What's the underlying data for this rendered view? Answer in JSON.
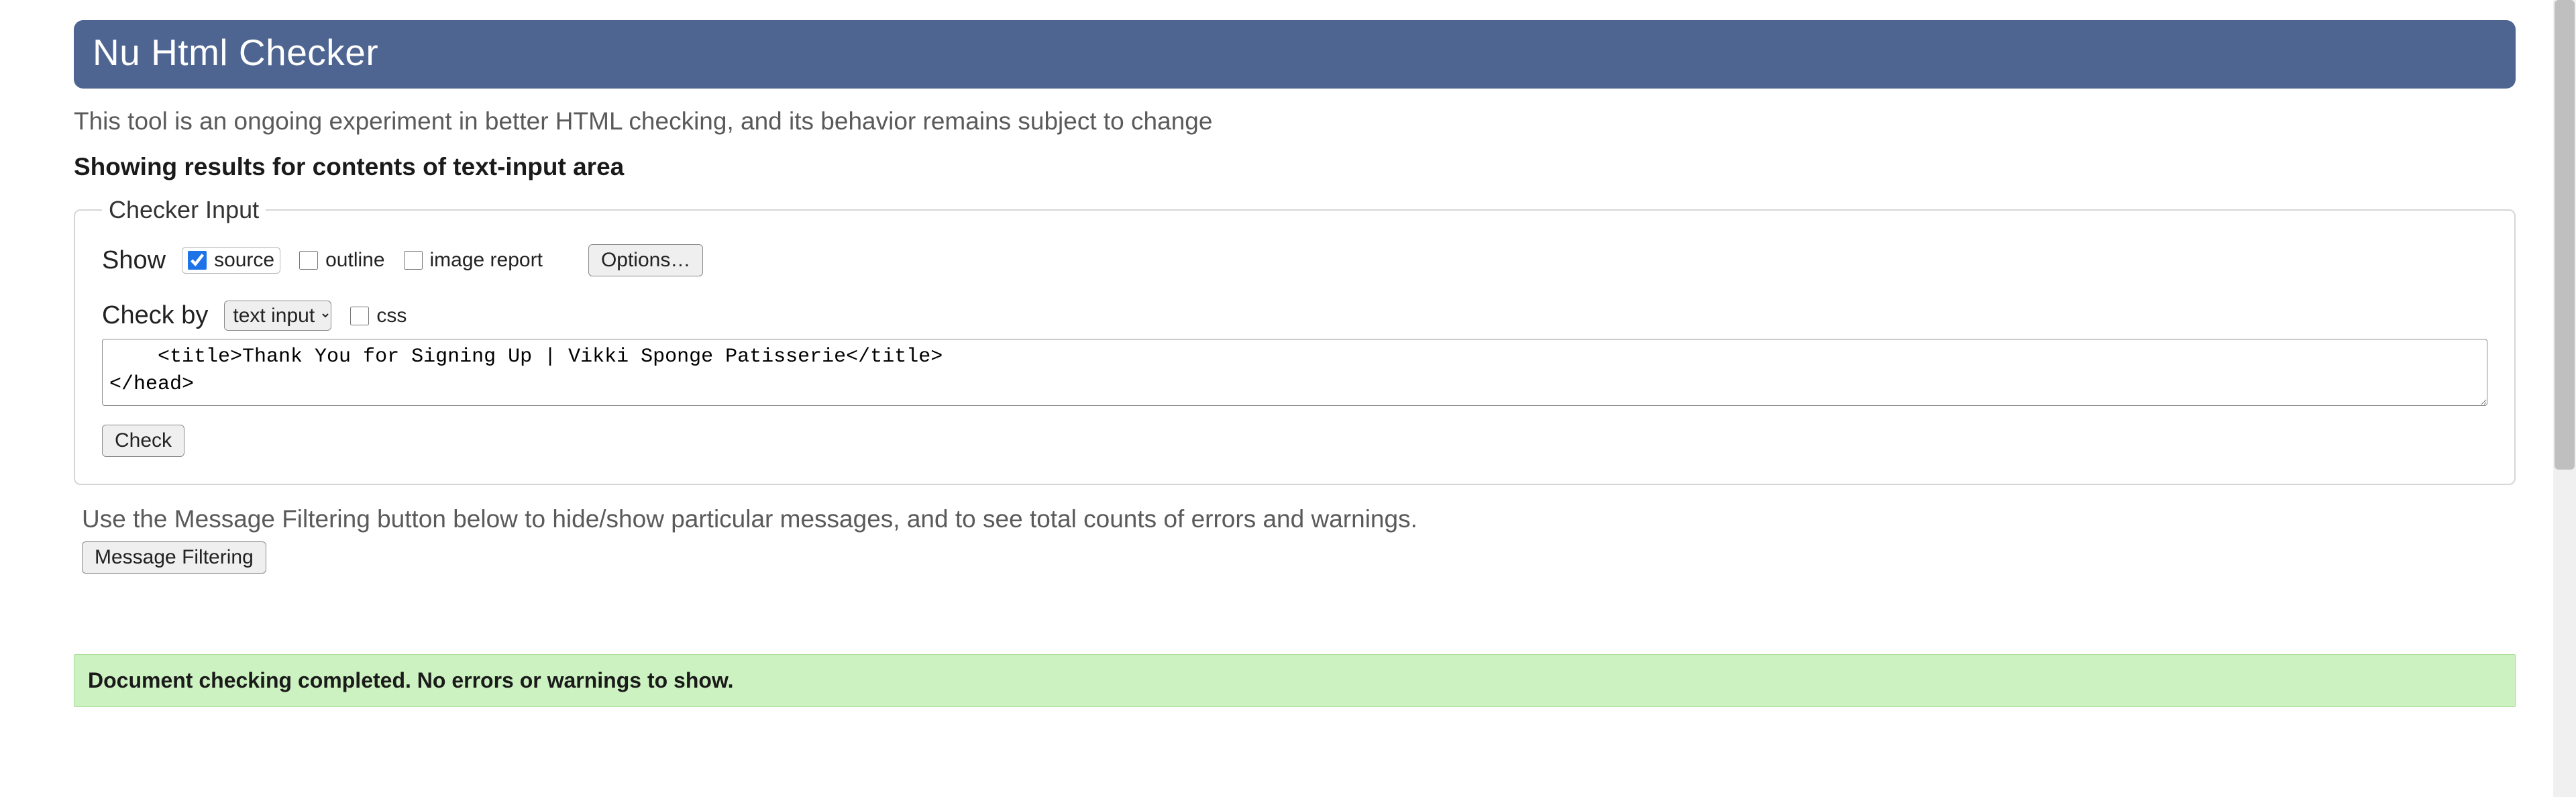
{
  "banner": {
    "title": "Nu Html Checker"
  },
  "tagline": "This tool is an ongoing experiment in better HTML checking, and its behavior remains subject to change",
  "results_heading": "Showing results for contents of text-input area",
  "checker": {
    "legend": "Checker Input",
    "show_label": "Show",
    "source_label": "source",
    "outline_label": "outline",
    "image_report_label": "image report",
    "options_button": "Options…",
    "check_by_label": "Check by",
    "check_by_selected": "text input",
    "css_label": "css",
    "textarea_value": "    <title>Thank You for Signing Up | Vikki Sponge Patisserie</title>\n</head>",
    "check_button": "Check"
  },
  "filtering": {
    "hint": "Use the Message Filtering button below to hide/show particular messages, and to see total counts of errors and warnings.",
    "button": "Message Filtering"
  },
  "result_bar": "Document checking completed. No errors or warnings to show."
}
